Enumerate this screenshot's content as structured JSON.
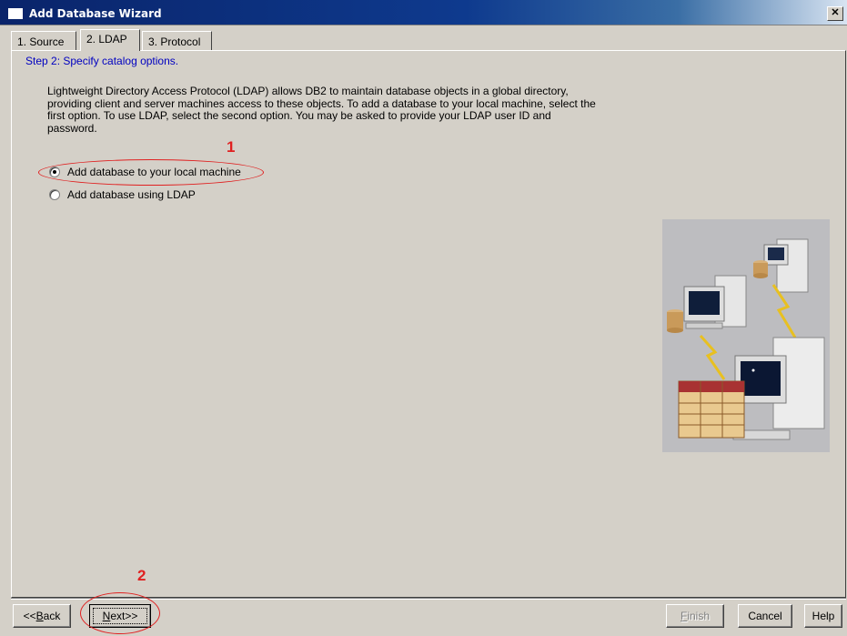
{
  "window": {
    "title": "Add Database Wizard",
    "close_glyph": "✕"
  },
  "tabs": [
    {
      "label": "1. Source",
      "active": false
    },
    {
      "label": "2. LDAP",
      "active": true
    },
    {
      "label": "3. Protocol",
      "active": false
    }
  ],
  "step": {
    "title": "Step 2: Specify catalog options.",
    "description_lines": [
      "Lightweight Directory Access Protocol (LDAP) allows DB2 to maintain database objects in a global directory,",
      "providing client and server machines access to these objects.  To add a database to your local machine, select the",
      "first option.  To use LDAP, select the second option.  You may be asked to provide your LDAP user ID and",
      "password."
    ]
  },
  "options": [
    {
      "label": "Add database to your local machine",
      "checked": true
    },
    {
      "label": "Add database using LDAP",
      "checked": false
    }
  ],
  "annotations": {
    "marker_1": "1",
    "marker_2": "2",
    "color": "#e02020"
  },
  "buttons": {
    "back": {
      "prefix": "<<",
      "mnemonic": "B",
      "rest": "ack"
    },
    "next": {
      "mnemonic": "N",
      "rest": "ext>>"
    },
    "finish": {
      "mnemonic": "F",
      "rest": "inish",
      "disabled": true
    },
    "cancel": "Cancel",
    "help": "Help"
  },
  "colors": {
    "titlebar": "#0a246a",
    "dialog_bg": "#d4d0c8",
    "step_title": "#0000c0"
  },
  "illustration": {
    "icons": [
      "database-server-icon",
      "computer-icon",
      "lightning-icon",
      "table-icon"
    ]
  }
}
